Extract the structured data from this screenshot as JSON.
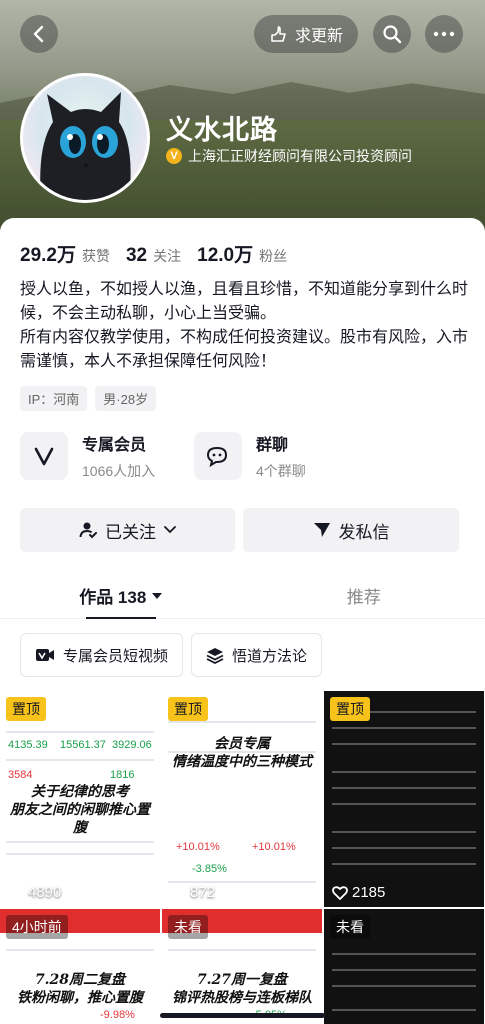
{
  "header": {
    "update_label": "求更新",
    "name": "义水北路",
    "verification": "上海汇正财经顾问有限公司投资顾问"
  },
  "stats": {
    "likes_value": "29.2万",
    "likes_label": "获赞",
    "following_value": "32",
    "following_label": "关注",
    "fans_value": "12.0万",
    "fans_label": "粉丝"
  },
  "bio": {
    "line1": "授人以鱼，不如授人以渔，且看且珍惜，不知道能分享到什么时候，不会主动私聊，小心上当受骗。",
    "line2": "所有内容仅教学使用，不构成任何投资建议。股市有风险，入市需谨慎，本人不承担保障任何风险！"
  },
  "tags": [
    "IP：河南",
    "男·28岁"
  ],
  "features": {
    "member_title": "专属会员",
    "member_sub": "1066人加入",
    "group_title": "群聊",
    "group_sub": "4个群聊"
  },
  "actions": {
    "follow_label": "已关注",
    "message_label": "发私信"
  },
  "tabs": {
    "works_label": "作品 138",
    "recommend_label": "推荐"
  },
  "chips": {
    "member_video": "专属会员短视频",
    "method": "悟道方法论"
  },
  "videos": [
    {
      "badge": "置顶",
      "likes": "4890",
      "overlay": "关于纪律的思考",
      "overlay2": "朋友之间的闲聊推心置腹"
    },
    {
      "badge": "置顶",
      "likes": "872",
      "overlay": "会员专属",
      "overlay2": "情绪温度中的三种模式"
    },
    {
      "badge": "置顶",
      "likes": "2185",
      "overlay": "",
      "overlay2": ""
    },
    {
      "badge": "4小时前",
      "overlay": "7.28周二复盘",
      "overlay2": "铁粉闲聊，推心置腹"
    },
    {
      "badge": "未看",
      "overlay": "7.27周一复盘",
      "overlay2": "锦评热股榜与连板梯队"
    },
    {
      "badge": "未看",
      "overlay": "",
      "overlay2": ""
    }
  ]
}
